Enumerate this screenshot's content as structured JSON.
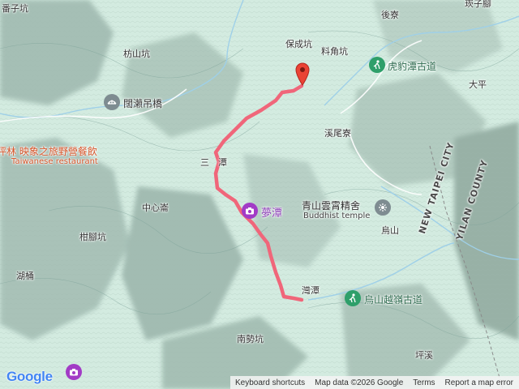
{
  "map": {
    "place_labels": [
      {
        "id": "fanzikeng",
        "text": "番子坑"
      },
      {
        "id": "houliao",
        "text": "後寮"
      },
      {
        "id": "baoliao",
        "text": "崁子腳"
      },
      {
        "id": "baochengkeng",
        "text": "保成坑"
      },
      {
        "id": "liaojiaokeng",
        "text": "料角坑"
      },
      {
        "id": "fangshankeng",
        "text": "枋山坑"
      },
      {
        "id": "daping",
        "text": "大平"
      },
      {
        "id": "xiweiliao",
        "text": "溪尾寮"
      },
      {
        "id": "santan",
        "text": "三　潭"
      },
      {
        "id": "zhongxinlun",
        "text": "中心崙"
      },
      {
        "id": "ganjiaokeng",
        "text": "柑腳坑"
      },
      {
        "id": "wushan",
        "text": "烏山"
      },
      {
        "id": "hutong",
        "text": "湖桶"
      },
      {
        "id": "wantan",
        "text": "灣潭"
      },
      {
        "id": "nanshikeng",
        "text": "南勢坑"
      },
      {
        "id": "pingxi",
        "text": "坪溪"
      }
    ],
    "pois": {
      "hubaotan": {
        "label": "虎豹潭古道",
        "icon": "hiking-trail-icon"
      },
      "guanlai": {
        "label": "闊瀨吊橋",
        "icon": "bridge-icon"
      },
      "restaurant": {
        "label": "坪林 映象之旅野營餐飲",
        "sublabel": "Taiwanese restaurant",
        "icon": "restaurant-icon"
      },
      "mengtan": {
        "label": "夢潭",
        "icon": "camera-icon"
      },
      "temple": {
        "label": "青山雲霄精舍",
        "sublabel": "Buddhist temple",
        "icon": "temple-icon"
      },
      "wushan_trail": {
        "label": "烏山越嶺古道",
        "icon": "hiking-trail-icon"
      }
    },
    "county_labels": {
      "taipei": "NEW TAIPEI CITY",
      "yilan": "YILAN COUNTY"
    },
    "colors": {
      "terrain": "#cfe6dc",
      "route": "#f0667a",
      "poi_green": "#2e9f6a",
      "poi_purple": "#a23bc6",
      "marker": "#ea4335"
    }
  },
  "footer": {
    "logo": "Google",
    "links": [
      "Keyboard shortcuts",
      "Map data ©2026 Google",
      "Terms",
      "Report a map error"
    ]
  }
}
